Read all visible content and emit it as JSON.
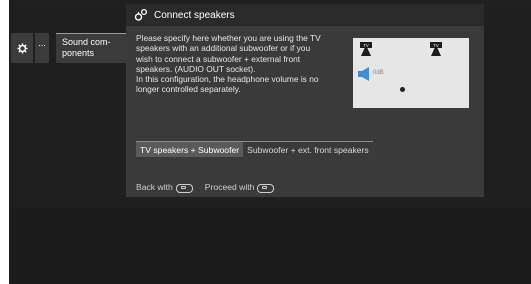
{
  "menu": {
    "dots_label": "...",
    "sound_label_line1": "Sound com-",
    "sound_label_line2": "ponents"
  },
  "dialog": {
    "title": "Connect speakers",
    "description_lines": [
      "Please specify here whether you are using the TV",
      "speakers with an additional subwoofer or if you",
      "wish to connect a subwoofer + external front",
      "speakers. (AUDIO OUT socket).",
      "In this configuration, the headphone volume is no",
      "longer controlled separately."
    ],
    "preview": {
      "tv_label_left": "TV",
      "tv_label_right": "TV",
      "volume_label": "0dB"
    },
    "tabs": [
      {
        "label": "TV speakers + Subwoofer",
        "active": true
      },
      {
        "label": "Subwoofer + ext. front speakers",
        "active": false
      }
    ],
    "footer": {
      "back_label": "Back with",
      "proceed_label": "Proceed with"
    }
  },
  "colors": {
    "background": "#1f1f1f",
    "dialog": "#3a3a3a",
    "header": "#2a2a2a",
    "active_tab": "#5a5a5a",
    "preview_bg": "#e6e6e6"
  },
  "icons": [
    "gear-icon",
    "speakers-icon",
    "tv-speaker-icon",
    "volume-speaker-icon",
    "back-key-icon",
    "proceed-key-icon"
  ]
}
